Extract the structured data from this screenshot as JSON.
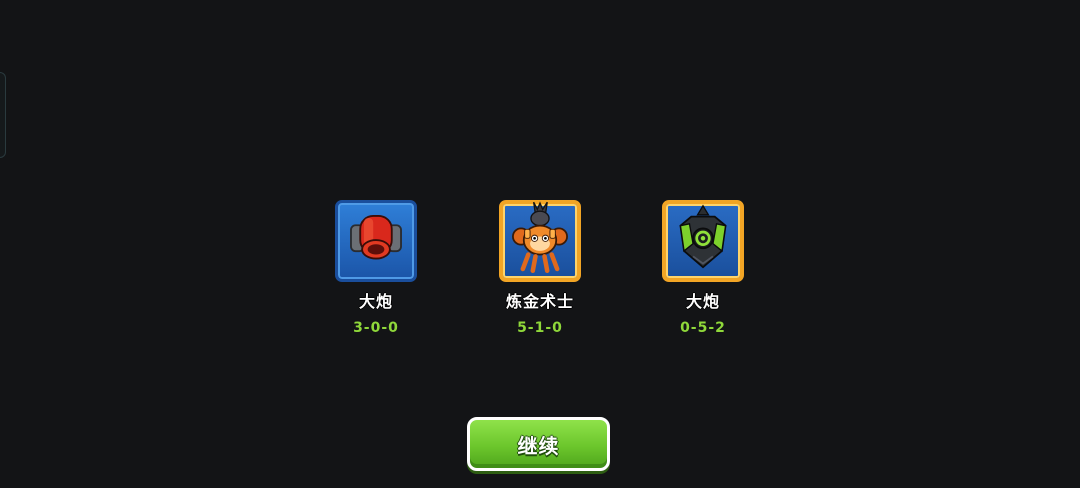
{
  "towers": [
    {
      "name": "大炮",
      "path": "3-0-0",
      "icon": "red-cannon-icon",
      "frame": "blue"
    },
    {
      "name": "炼金术士",
      "path": "5-1-0",
      "icon": "alchemist-monkey-icon",
      "frame": "gold"
    },
    {
      "name": "大炮",
      "path": "0-5-2",
      "icon": "green-bomb-launcher-icon",
      "frame": "gold"
    }
  ],
  "continue_button": {
    "label": "继续"
  },
  "colors": {
    "background": "#131416",
    "path_text": "#8fd83a",
    "button_green": "#6cc62c",
    "frame_gold": "#f2a525",
    "frame_blue": "#2f7fd8"
  }
}
